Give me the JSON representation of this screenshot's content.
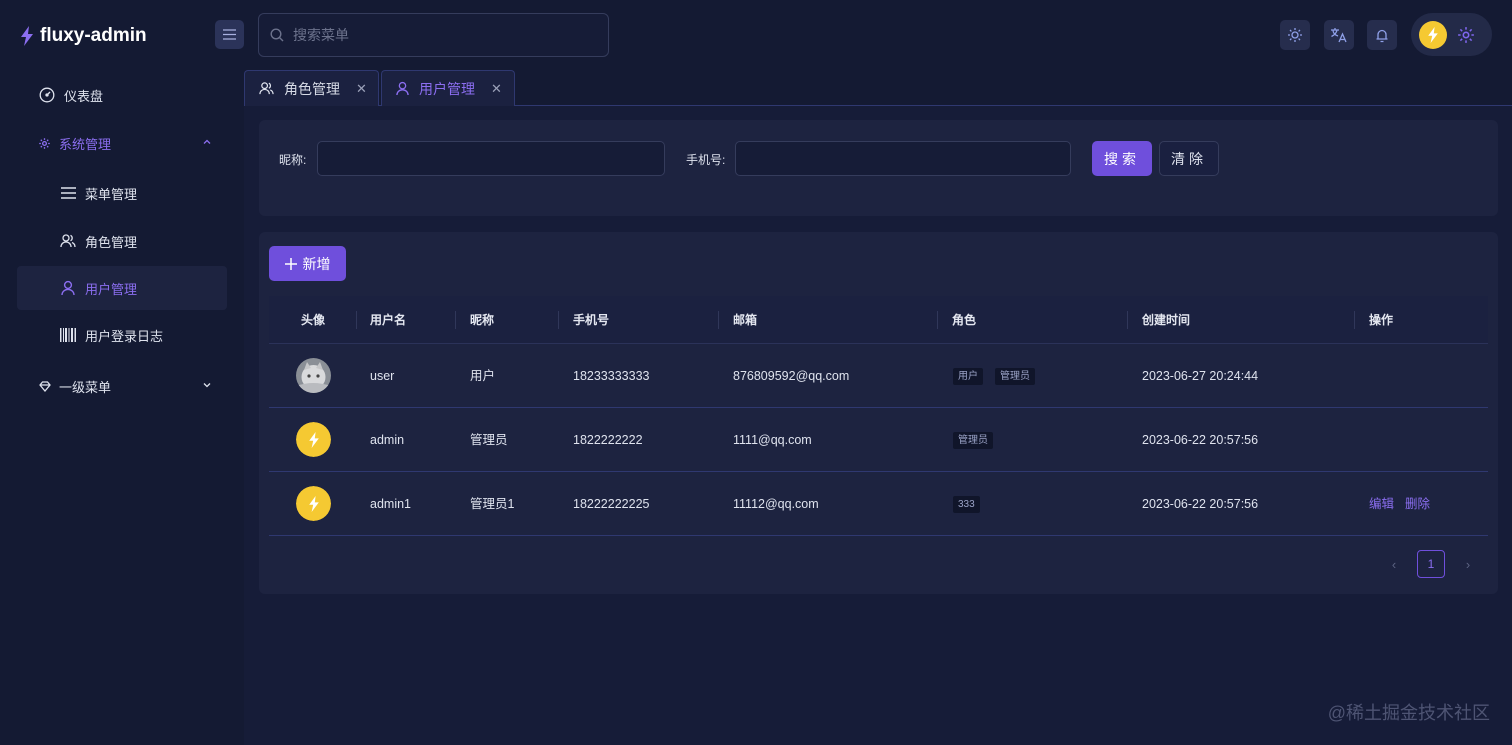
{
  "app": {
    "name": "fluxy-admin"
  },
  "sidebar": {
    "items": [
      {
        "label": "仪表盘",
        "icon": "dashboard-icon"
      },
      {
        "label": "系统管理",
        "icon": "gear-icon",
        "expanded": true
      },
      {
        "label": "菜单管理",
        "icon": "menu-list-icon"
      },
      {
        "label": "角色管理",
        "icon": "users-icon"
      },
      {
        "label": "用户管理",
        "icon": "user-icon",
        "active": true
      },
      {
        "label": "用户登录日志",
        "icon": "barcode-icon"
      },
      {
        "label": "一级菜单",
        "icon": "diamond-icon",
        "expanded": false
      }
    ]
  },
  "header": {
    "search_placeholder": "搜索菜单"
  },
  "tabs": [
    {
      "label": "角色管理",
      "icon": "users-icon"
    },
    {
      "label": "用户管理",
      "icon": "user-icon",
      "active": true
    }
  ],
  "filters": {
    "nickname_label": "昵称:",
    "nickname_value": "",
    "phone_label": "手机号:",
    "phone_value": "",
    "search_label": "搜索",
    "clear_label": "清除"
  },
  "table": {
    "add_label": "新增",
    "columns": [
      "头像",
      "用户名",
      "昵称",
      "手机号",
      "邮箱",
      "角色",
      "创建时间",
      "操作"
    ],
    "rows": [
      {
        "avatar": "cat-photo",
        "username": "user",
        "nickname": "用户",
        "phone": "18233333333",
        "email": "876809592@qq.com",
        "roles": [
          "用户",
          "管理员"
        ],
        "created": "2023-06-27 20:24:44",
        "actions": []
      },
      {
        "avatar": "bolt",
        "username": "admin",
        "nickname": "管理员",
        "phone": "1822222222",
        "email": "1111@qq.com",
        "roles": [
          "管理员"
        ],
        "created": "2023-06-22 20:57:56",
        "actions": []
      },
      {
        "avatar": "bolt",
        "username": "admin1",
        "nickname": "管理员1",
        "phone": "18222222225",
        "email": "11112@qq.com",
        "roles": [
          "333"
        ],
        "created": "2023-06-22 20:57:56",
        "actions": [
          "编辑",
          "删除"
        ]
      }
    ]
  },
  "pagination": {
    "current": "1",
    "prev": "‹",
    "next": "›"
  },
  "watermark": "@稀土掘金技术社区",
  "colors": {
    "accent": "#6f4fdc",
    "accent_text": "#8b6ef0",
    "bg": "#141a33",
    "card": "#1d2340",
    "avatar_yellow": "#f5c932"
  }
}
